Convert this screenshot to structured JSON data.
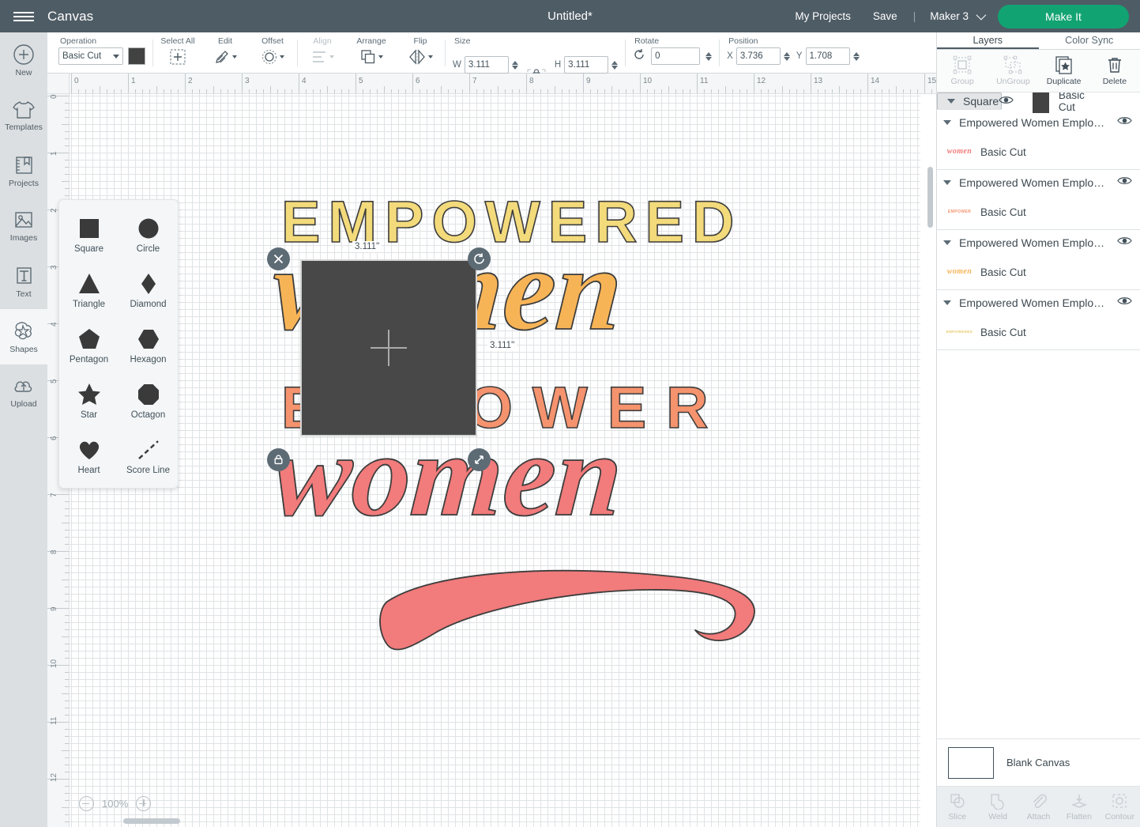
{
  "topbar": {
    "menu_icon": "hamburger-icon",
    "app_section": "Canvas",
    "document_title": "Untitled*",
    "my_projects": "My Projects",
    "save": "Save",
    "separator": "|",
    "machine": "Maker 3",
    "make_it": "Make It",
    "accent_green": "#12a372",
    "bar_color": "#4e5c65"
  },
  "rail": [
    {
      "label": "New",
      "icon": "plus-circle-icon",
      "active": false
    },
    {
      "label": "Templates",
      "icon": "tshirt-icon",
      "active": false
    },
    {
      "label": "Projects",
      "icon": "book-bookmark-icon",
      "active": false
    },
    {
      "label": "Images",
      "icon": "picture-icon",
      "active": false
    },
    {
      "label": "Text",
      "icon": "text-t-icon",
      "active": false
    },
    {
      "label": "Shapes",
      "icon": "star-blob-icon",
      "active": true
    },
    {
      "label": "Upload",
      "icon": "cloud-upload-icon",
      "active": false
    }
  ],
  "toolbar": {
    "operation_label": "Operation",
    "operation_value": "Basic Cut",
    "operation_color": "#424242",
    "select_all": "Select All",
    "edit": "Edit",
    "offset": "Offset",
    "align": "Align",
    "arrange": "Arrange",
    "flip": "Flip",
    "size_label": "Size",
    "w_label": "W",
    "w_value": "3.111",
    "h_label": "H",
    "h_value": "3.111",
    "lock_icon": "lock-icon",
    "rotate_label": "Rotate",
    "rotate_value": "0",
    "position_label": "Position",
    "x_label": "X",
    "x_value": "3.736",
    "y_label": "Y",
    "y_value": "1.708"
  },
  "shapes_panel": {
    "items": [
      {
        "label": "Square",
        "icon": "square-shape-icon"
      },
      {
        "label": "Circle",
        "icon": "circle-shape-icon"
      },
      {
        "label": "Triangle",
        "icon": "triangle-shape-icon"
      },
      {
        "label": "Diamond",
        "icon": "diamond-shape-icon"
      },
      {
        "label": "Pentagon",
        "icon": "pentagon-shape-icon"
      },
      {
        "label": "Hexagon",
        "icon": "hexagon-shape-icon"
      },
      {
        "label": "Star",
        "icon": "star-shape-icon"
      },
      {
        "label": "Octagon",
        "icon": "octagon-shape-icon"
      },
      {
        "label": "Heart",
        "icon": "heart-shape-icon"
      },
      {
        "label": "Score Line",
        "icon": "score-line-icon"
      }
    ]
  },
  "canvas": {
    "zoom_level": "100%",
    "h_ruler_ticks": [
      "0",
      "1",
      "2",
      "3",
      "4",
      "5",
      "6",
      "7",
      "8",
      "9",
      "10",
      "11",
      "12",
      "13",
      "14",
      "15"
    ],
    "v_ruler_ticks": [
      "0",
      "1",
      "2",
      "3",
      "4",
      "5",
      "6",
      "7",
      "8",
      "9",
      "10",
      "11",
      "12"
    ],
    "selection": {
      "width_label": "3.111\"",
      "height_label": "3.111\"",
      "fill": "#484848",
      "delete_icon": "close-x-icon",
      "rotate_icon": "rotate-icon",
      "lock_icon": "lock-closed-icon",
      "resize_icon": "resize-diagonal-icon"
    },
    "artwork": {
      "line1": "EMPOWERED",
      "line2": "women",
      "line3": "EMPOWER",
      "line4": "women",
      "colors": {
        "yellow": "#F3DA7B",
        "orange": "#F7B457",
        "salmon": "#F5936E",
        "coral": "#F27B7B",
        "outline": "#3d3d3d"
      }
    }
  },
  "right_panel": {
    "tabs": [
      {
        "label": "Layers",
        "active": true
      },
      {
        "label": "Color Sync",
        "active": false
      }
    ],
    "actions": [
      {
        "label": "Group",
        "icon": "group-icon",
        "enabled": false
      },
      {
        "label": "UnGroup",
        "icon": "ungroup-icon",
        "enabled": false
      },
      {
        "label": "Duplicate",
        "icon": "duplicate-icon",
        "enabled": true
      },
      {
        "label": "Delete",
        "icon": "trash-icon",
        "enabled": true
      }
    ],
    "layers": [
      {
        "name": "Square",
        "operation": "Basic Cut",
        "thumb_kind": "square",
        "thumb_color": "#424242",
        "thumb_text": "",
        "selected": true
      },
      {
        "name": "Empowered Women Emplo…",
        "operation": "Basic Cut",
        "thumb_kind": "script",
        "thumb_color": "#F27B7B",
        "thumb_text": "women",
        "selected": false
      },
      {
        "name": "Empowered Women Emplo…",
        "operation": "Basic Cut",
        "thumb_kind": "caps",
        "thumb_color": "#F5936E",
        "thumb_text": "EMPOWER",
        "selected": false
      },
      {
        "name": "Empowered Women Emplo…",
        "operation": "Basic Cut",
        "thumb_kind": "script",
        "thumb_color": "#F7B457",
        "thumb_text": "women",
        "selected": false
      },
      {
        "name": "Empowered Women Emplo…",
        "operation": "Basic Cut",
        "thumb_kind": "caps",
        "thumb_color": "#F3DA7B",
        "thumb_text": "EMPOWERED",
        "selected": false
      }
    ],
    "canvas_row": {
      "label": "Blank Canvas"
    },
    "bottom_tools": [
      {
        "label": "Slice",
        "icon": "slice-icon"
      },
      {
        "label": "Weld",
        "icon": "weld-icon"
      },
      {
        "label": "Attach",
        "icon": "paperclip-icon"
      },
      {
        "label": "Flatten",
        "icon": "flatten-icon"
      },
      {
        "label": "Contour",
        "icon": "contour-icon"
      }
    ]
  }
}
